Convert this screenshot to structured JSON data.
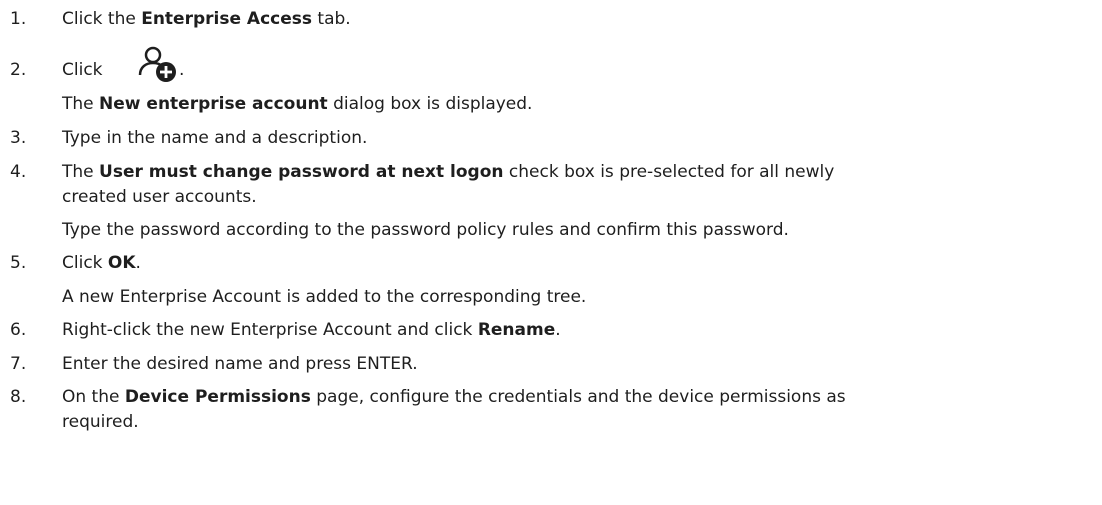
{
  "steps": [
    {
      "number": "1.",
      "pre": "Click the ",
      "bold": "Enterprise Access",
      "post": " tab."
    },
    {
      "number": "2.",
      "pre": "Click ",
      "icon": "add-user-icon",
      "post": ".",
      "follow": {
        "pre": "The ",
        "bold": "New enterprise account",
        "post": " dialog box is displayed."
      }
    },
    {
      "number": "3.",
      "text": "Type in the name and a description."
    },
    {
      "number": "4.",
      "pre": "The ",
      "bold": "User must change password at next logon",
      "post": " check box is pre-selected for all newly",
      "wrap": "created user accounts.",
      "follow": "Type the password according to the password policy rules and confirm this password."
    },
    {
      "number": "5.",
      "pre": "Click ",
      "bold": "OK",
      "post": ".",
      "follow": "A new Enterprise Account is added to the corresponding tree."
    },
    {
      "number": "6.",
      "pre": "Right-click the new Enterprise Account and click ",
      "bold": "Rename",
      "post": "."
    },
    {
      "number": "7.",
      "text": "Enter the desired name and press ENTER."
    },
    {
      "number": "8.",
      "pre": "On the ",
      "bold": "Device Permissions",
      "post": " page, configure the credentials and the device permissions as",
      "wrap": "required."
    }
  ],
  "colors": {
    "text": "#1e1e1e",
    "icon": "#1e1e1e"
  }
}
